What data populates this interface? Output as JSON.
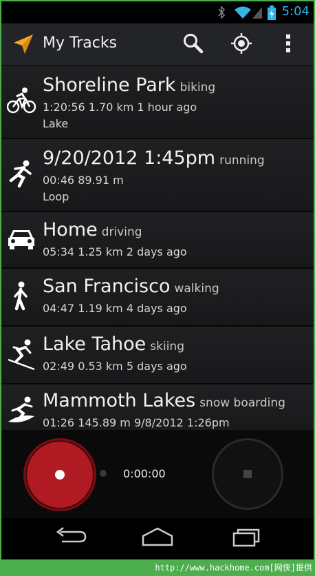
{
  "status_bar": {
    "time": "5:04",
    "icons": [
      "bluetooth-icon",
      "wifi-icon",
      "signal-icon",
      "battery-charging-icon"
    ]
  },
  "action_bar": {
    "title": "My Tracks",
    "icons": [
      "search-icon",
      "my-location-icon",
      "overflow-menu-icon"
    ]
  },
  "tracks": [
    {
      "name": "Shoreline Park",
      "activity": "biking",
      "stats": "1:20:56  1.70 km  1 hour ago",
      "description": "Lake",
      "icon": "biking-icon"
    },
    {
      "name": "9/20/2012 1:45pm",
      "activity": "running",
      "stats": "00:46  89.91 m",
      "description": "Loop",
      "icon": "running-icon"
    },
    {
      "name": "Home",
      "activity": "driving",
      "stats": "05:34  1.25 km  2 days ago",
      "description": "",
      "icon": "car-icon"
    },
    {
      "name": "San Francisco",
      "activity": "walking",
      "stats": "04:47  1.19 km  4 days ago",
      "description": "",
      "icon": "walking-icon"
    },
    {
      "name": "Lake Tahoe",
      "activity": "skiing",
      "stats": "02:49  0.53 km  5 days ago",
      "description": "",
      "icon": "skiing-icon"
    },
    {
      "name": "Mammoth Lakes",
      "activity": "snow boarding",
      "stats": "01:26  145.89 m  9/8/2012 1:26pm",
      "description": "",
      "icon": "snowboarding-icon"
    }
  ],
  "recording": {
    "timer": "0:00:00"
  },
  "nav_bar": {
    "buttons": [
      "back-icon",
      "home-icon",
      "recent-apps-icon"
    ]
  },
  "watermark": "http://www.hackhome.com[网侠]提供",
  "colors": {
    "accent": "#33b5e5",
    "record": "#b01a22",
    "app_icon": "#f5a623",
    "frame": "#4cae4c"
  }
}
